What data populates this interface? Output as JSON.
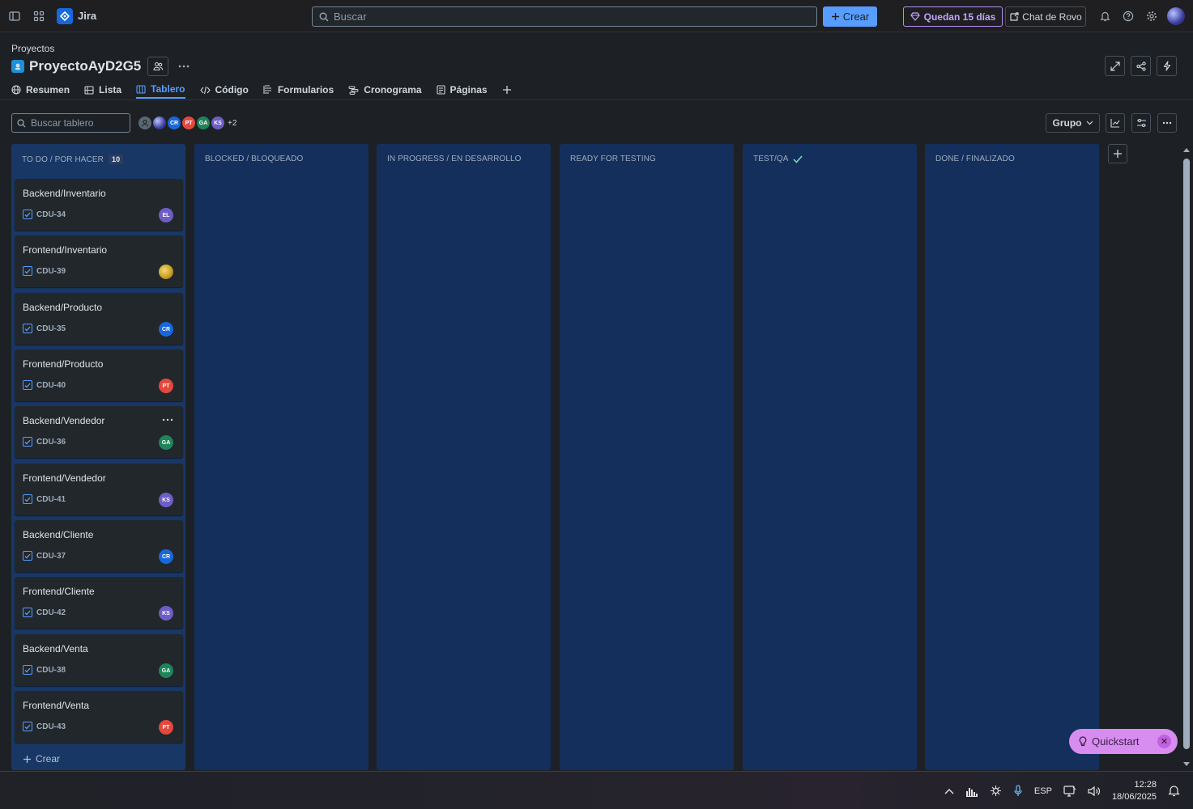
{
  "topbar": {
    "app_name": "Jira",
    "search_placeholder": "Buscar",
    "create_label": "Crear",
    "trial_label": "Quedan 15 días",
    "rovo_label": "Chat de Rovo"
  },
  "project": {
    "breadcrumb": "Proyectos",
    "title": "ProyectoAyD2G5"
  },
  "tabs": [
    {
      "label": "Resumen",
      "icon": "globe-icon",
      "active": false
    },
    {
      "label": "Lista",
      "icon": "list-icon",
      "active": false
    },
    {
      "label": "Tablero",
      "icon": "board-icon",
      "active": true
    },
    {
      "label": "Código",
      "icon": "code-icon",
      "active": false
    },
    {
      "label": "Formularios",
      "icon": "form-icon",
      "active": false
    },
    {
      "label": "Cronograma",
      "icon": "timeline-icon",
      "active": false
    },
    {
      "label": "Páginas",
      "icon": "pages-icon",
      "active": false
    }
  ],
  "board": {
    "search_placeholder": "Buscar tablero",
    "avatars": [
      {
        "initials": "",
        "color": "#596773"
      },
      {
        "initials": "",
        "color": "#3b3f9e"
      },
      {
        "initials": "CR",
        "color": "#1868db"
      },
      {
        "initials": "PT",
        "color": "#e2483d"
      },
      {
        "initials": "GA",
        "color": "#1f845a"
      },
      {
        "initials": "KS",
        "color": "#6e5dc6"
      }
    ],
    "avatars_more": "+2",
    "group_label": "Grupo"
  },
  "columns": [
    {
      "name": "TO DO / POR HACER",
      "count": "10"
    },
    {
      "name": "BLOCKED / BLOQUEADO",
      "count": ""
    },
    {
      "name": "IN PROGRESS / EN DESARROLLO",
      "count": ""
    },
    {
      "name": "READY FOR TESTING",
      "count": ""
    },
    {
      "name": "TEST/QA",
      "count": ""
    },
    {
      "name": "DONE / FINALIZADO",
      "count": ""
    }
  ],
  "cards": [
    {
      "title": "Backend/Inventario",
      "key": "CDU-34",
      "assignee": "EL",
      "color": "#6e5dc6"
    },
    {
      "title": "Frontend/Inventario",
      "key": "CDU-39",
      "assignee": "",
      "color": "#c9a227"
    },
    {
      "title": "Backend/Producto",
      "key": "CDU-35",
      "assignee": "CR",
      "color": "#1868db"
    },
    {
      "title": "Frontend/Producto",
      "key": "CDU-40",
      "assignee": "PT",
      "color": "#e2483d"
    },
    {
      "title": "Backend/Vendedor",
      "key": "CDU-36",
      "assignee": "GA",
      "color": "#1f845a"
    },
    {
      "title": "Frontend/Vendedor",
      "key": "CDU-41",
      "assignee": "KS",
      "color": "#6e5dc6"
    },
    {
      "title": "Backend/Cliente",
      "key": "CDU-37",
      "assignee": "CR",
      "color": "#1868db"
    },
    {
      "title": "Frontend/Cliente",
      "key": "CDU-42",
      "assignee": "KS",
      "color": "#6e5dc6"
    },
    {
      "title": "Backend/Venta",
      "key": "CDU-38",
      "assignee": "GA",
      "color": "#1f845a"
    },
    {
      "title": "Frontend/Venta",
      "key": "CDU-43",
      "assignee": "PT",
      "color": "#e2483d"
    }
  ],
  "column_create_label": "Crear",
  "quickstart_label": "Quickstart",
  "taskbar": {
    "language": "ESP",
    "time": "12:28",
    "date": "18/06/2025"
  }
}
